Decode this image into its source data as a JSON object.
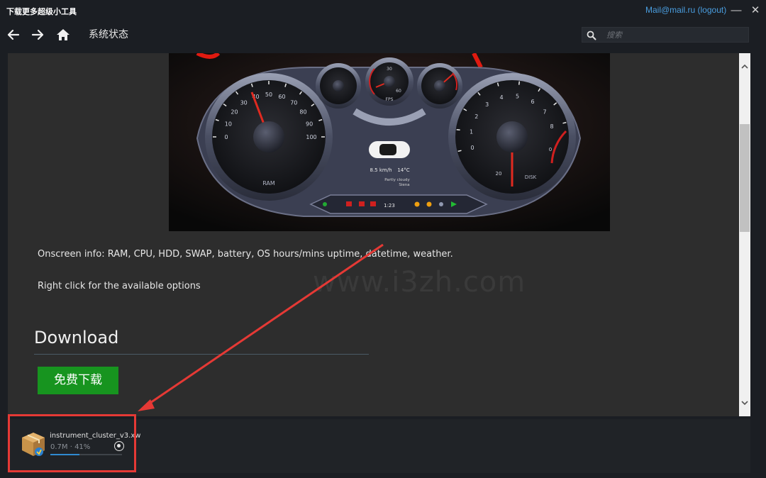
{
  "window": {
    "app_title": "下载更多超级小工具",
    "account_label": "Mail@mail.ru (logout)",
    "minimize_glyph": "—",
    "close_glyph": "✕"
  },
  "nav": {
    "back_icon": "arrow-left-icon",
    "forward_icon": "arrow-right-icon",
    "home_icon": "home-icon",
    "page_title": "系统状态"
  },
  "search": {
    "placeholder": "搜索",
    "value": ""
  },
  "dashboard": {
    "ram_ticks": [
      "0",
      "10",
      "20",
      "30",
      "40",
      "50",
      "60",
      "70",
      "80",
      "90",
      "100"
    ],
    "ram_label": "RAM",
    "disk_ticks": [
      "0",
      "1",
      "2",
      "3",
      "4",
      "5",
      "6",
      "7",
      "8"
    ],
    "disk_label": "DISK",
    "disk_low": "20",
    "disk_zero": "0",
    "fps_top": "30",
    "fps_right": "60",
    "fps_label": "FPS",
    "speed": "8.5 km/h",
    "temperature": "14°C",
    "weather": "Partly cloudy",
    "city": "Siena",
    "clock": "1:23"
  },
  "content": {
    "info_line": "Onscreen info: RAM, CPU, HDD, SWAP, battery, OS hours/mins uptime, datetime, weather.",
    "hint_line": "Right click for the available options",
    "watermark": "www.i3zh.com",
    "download_heading": "Download",
    "download_button": "免费下载"
  },
  "download_item": {
    "file_name": "instrument_cluster_v3.xw",
    "status": "0.7M · 41%",
    "progress": 0.41,
    "icon": "package-icon"
  },
  "colors": {
    "accent_link": "#4a9ee0",
    "download_button": "#17941f",
    "progress_fill": "#2f8ad0",
    "annotation_red": "#e53935",
    "gauge_red": "#d0201f"
  }
}
